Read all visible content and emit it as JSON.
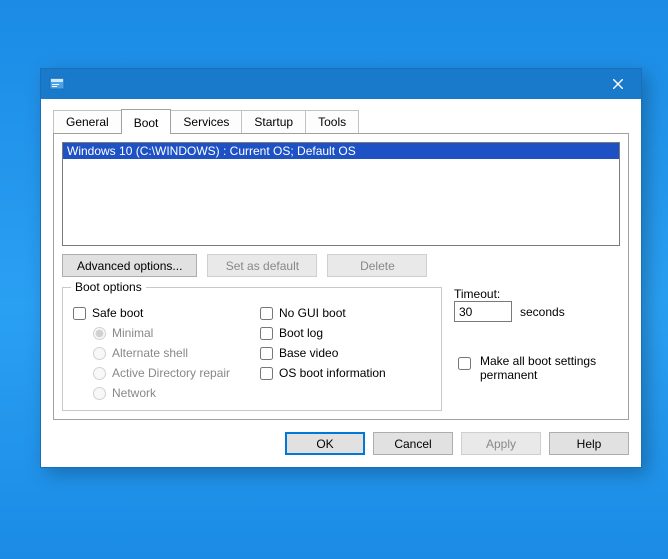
{
  "window": {
    "title": ""
  },
  "tabs": [
    {
      "label": "General"
    },
    {
      "label": "Boot"
    },
    {
      "label": "Services"
    },
    {
      "label": "Startup"
    },
    {
      "label": "Tools"
    }
  ],
  "active_tab_index": 1,
  "boot_entries": [
    "Windows 10 (C:\\WINDOWS) : Current OS; Default OS"
  ],
  "buttons": {
    "advanced": "Advanced options...",
    "set_default": "Set as default",
    "delete": "Delete"
  },
  "boot_options": {
    "legend": "Boot options",
    "safe_boot": "Safe boot",
    "radios": {
      "minimal": "Minimal",
      "alt_shell": "Alternate shell",
      "ad_repair": "Active Directory repair",
      "network": "Network"
    },
    "no_gui": "No GUI boot",
    "boot_log": "Boot log",
    "base_video": "Base video",
    "os_info": "OS boot information"
  },
  "timeout": {
    "label": "Timeout:",
    "value": "30",
    "unit": "seconds"
  },
  "make_permanent": "Make all boot settings permanent",
  "dialog": {
    "ok": "OK",
    "cancel": "Cancel",
    "apply": "Apply",
    "help": "Help"
  }
}
